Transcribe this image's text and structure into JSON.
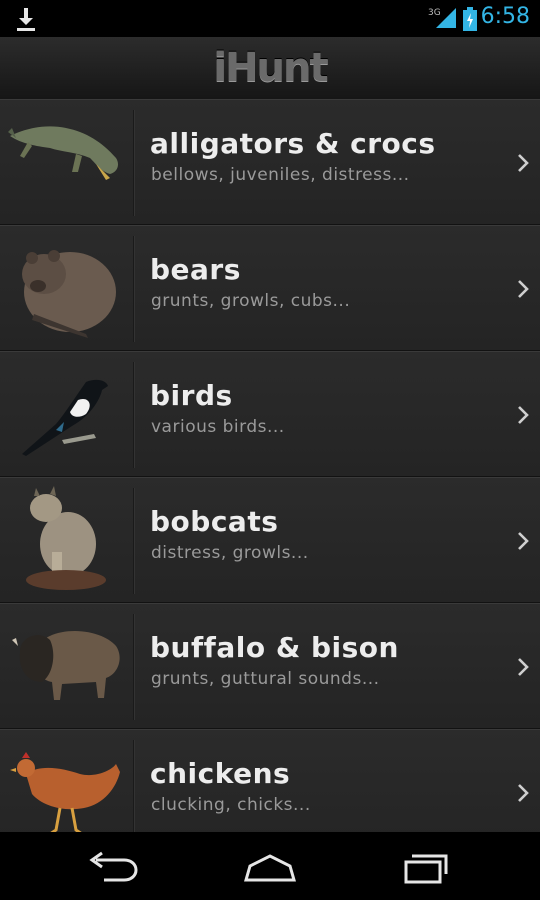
{
  "status_bar": {
    "time": "6:58",
    "network_label": "3G",
    "icons": [
      "download-icon",
      "signal-icon",
      "battery-icon"
    ],
    "accent_color": "#33b5e5"
  },
  "app": {
    "title": "iHunt"
  },
  "categories": [
    {
      "title": "alligators & crocs",
      "subtitle": "bellows, juveniles, distress...",
      "image": "alligator-image"
    },
    {
      "title": "bears",
      "subtitle": "grunts, growls, cubs...",
      "image": "bear-image"
    },
    {
      "title": "birds",
      "subtitle": "various birds...",
      "image": "magpie-image"
    },
    {
      "title": "bobcats",
      "subtitle": "distress, growls...",
      "image": "bobcat-image"
    },
    {
      "title": "buffalo & bison",
      "subtitle": "grunts, guttural sounds...",
      "image": "bison-image"
    },
    {
      "title": "chickens",
      "subtitle": "clucking, chicks...",
      "image": "chicken-image"
    }
  ],
  "nav_bar": {
    "icons": [
      "back-icon",
      "home-icon",
      "recent-apps-icon"
    ]
  }
}
